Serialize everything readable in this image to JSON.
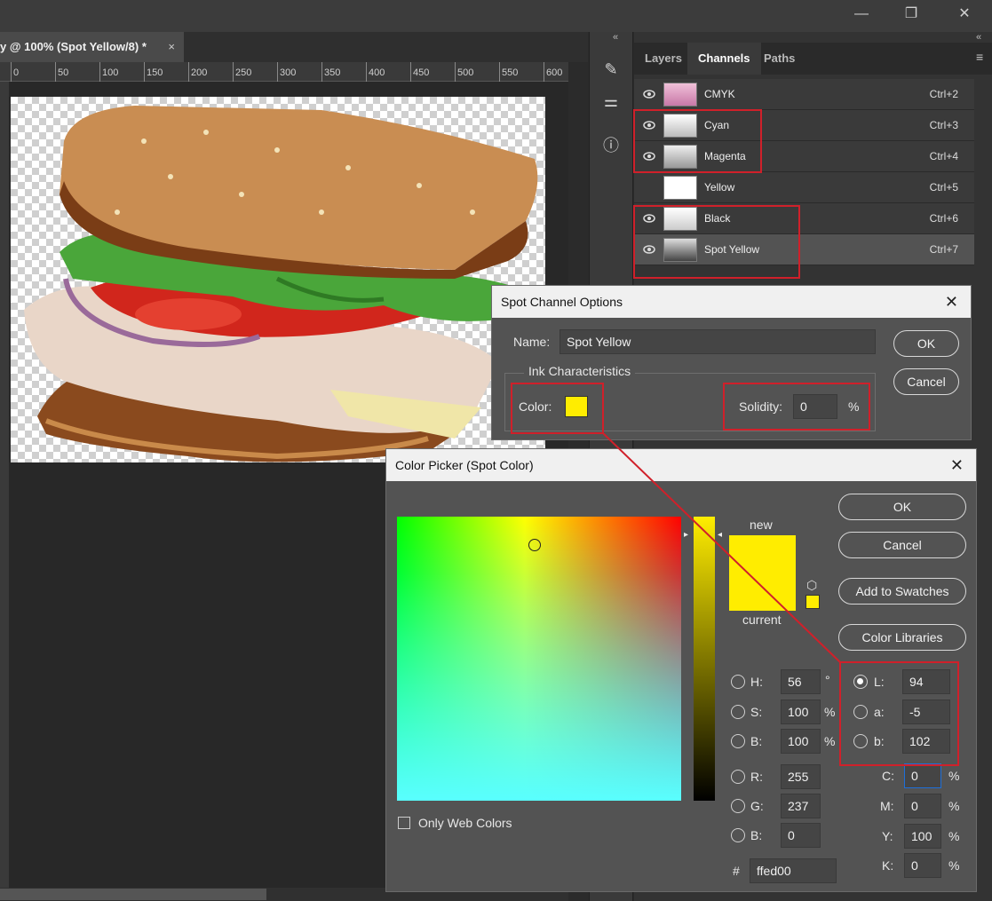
{
  "window": {
    "minimize": "—",
    "maximize": "❐",
    "close": "✕"
  },
  "document_tab": {
    "title": "y @ 100% (Spot Yellow/8) *",
    "close": "×"
  },
  "ruler": {
    "ticks": [
      "0",
      "50",
      "100",
      "150",
      "200",
      "250",
      "300",
      "350",
      "400",
      "450",
      "500",
      "550",
      "600"
    ]
  },
  "panel": {
    "collapse": "«",
    "tabs": [
      "Layers",
      "Channels",
      "Paths"
    ],
    "active_tab": "Channels",
    "channels": [
      {
        "name": "CMYK",
        "shortcut": "Ctrl+2"
      },
      {
        "name": "Cyan",
        "shortcut": "Ctrl+3"
      },
      {
        "name": "Magenta",
        "shortcut": "Ctrl+4"
      },
      {
        "name": "Yellow",
        "shortcut": "Ctrl+5"
      },
      {
        "name": "Black",
        "shortcut": "Ctrl+6"
      },
      {
        "name": "Spot Yellow",
        "shortcut": "Ctrl+7"
      }
    ]
  },
  "spot_dialog": {
    "title": "Spot Channel Options",
    "close": "✕",
    "name_label": "Name:",
    "name_value": "Spot Yellow",
    "ok": "OK",
    "cancel": "Cancel",
    "ink_label": "Ink Characteristics",
    "color_label": "Color:",
    "color_value": "#ffed00",
    "solidity_label": "Solidity:",
    "solidity_value": "0",
    "solidity_unit": "%"
  },
  "picker": {
    "title": "Color Picker (Spot Color)",
    "close": "✕",
    "ok": "OK",
    "cancel": "Cancel",
    "add_swatches": "Add to Swatches",
    "color_libraries": "Color Libraries",
    "new_label": "new",
    "current_label": "current",
    "only_web": "Only Web Colors",
    "fields": {
      "H": {
        "label": "H:",
        "value": "56",
        "unit": "°"
      },
      "S": {
        "label": "S:",
        "value": "100",
        "unit": "%"
      },
      "Bv": {
        "label": "B:",
        "value": "100",
        "unit": "%"
      },
      "R": {
        "label": "R:",
        "value": "255"
      },
      "G": {
        "label": "G:",
        "value": "237"
      },
      "Bl": {
        "label": "B:",
        "value": "0"
      },
      "L": {
        "label": "L:",
        "value": "94"
      },
      "a": {
        "label": "a:",
        "value": "-5"
      },
      "b": {
        "label": "b:",
        "value": "102"
      },
      "C": {
        "label": "C:",
        "value": "0",
        "unit": "%"
      },
      "M": {
        "label": "M:",
        "value": "0",
        "unit": "%"
      },
      "Y": {
        "label": "Y:",
        "value": "100",
        "unit": "%"
      },
      "K": {
        "label": "K:",
        "value": "0",
        "unit": "%"
      }
    },
    "hex_label": "#",
    "hex_value": "ffed00",
    "new_color": "#ffed00",
    "current_color": "#ffed00"
  },
  "colors": {
    "accent_red": "#d0202a",
    "spot_yellow": "#ffed00"
  }
}
